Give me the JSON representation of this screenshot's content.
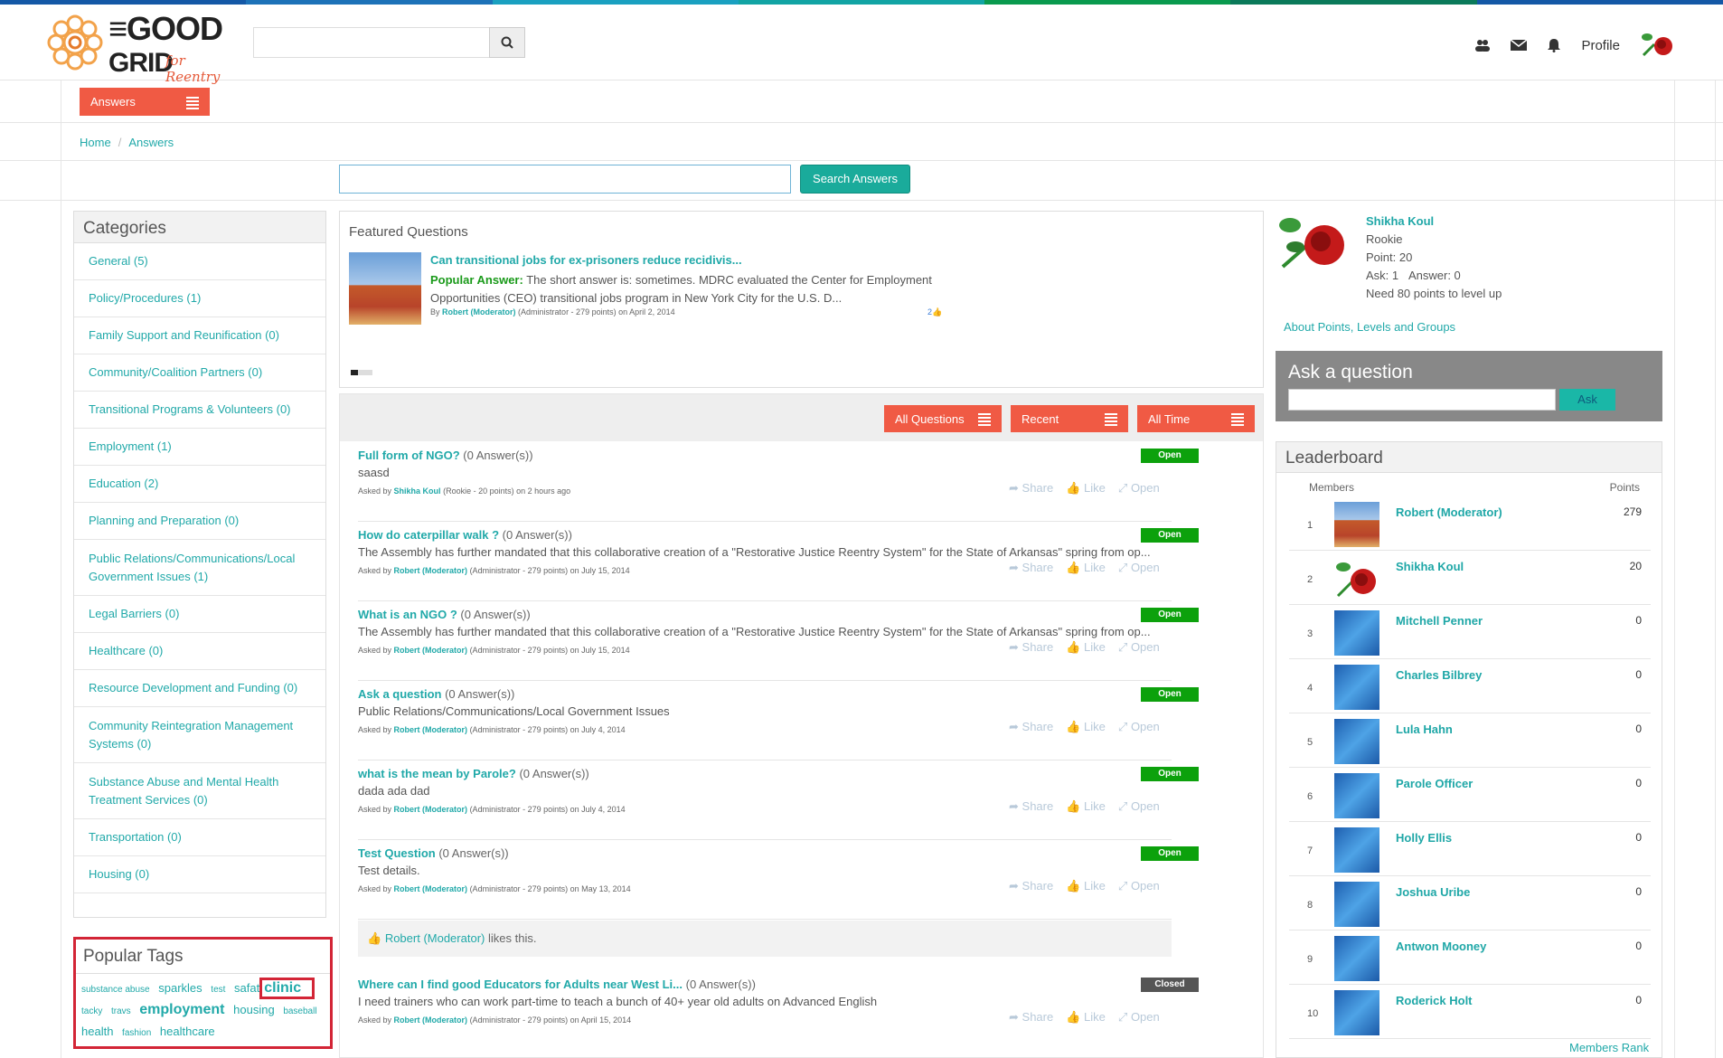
{
  "colors": {
    "bar": [
      "#1458a6",
      "#1d72b8",
      "#1aa0c0",
      "#12a4a4",
      "#0a9a4e",
      "#0b7a5a",
      "#1458a6"
    ],
    "accent": "#f05a44",
    "teal": "#1fa7a7"
  },
  "header": {
    "logo_main": "THE GOOD GRID",
    "logo_sub": "for Reentry",
    "search_placeholder": "",
    "profile": "Profile"
  },
  "answers_menu": "Answers",
  "breadcrumb": {
    "home": "Home",
    "current": "Answers"
  },
  "search_answers": "Search Answers",
  "categories": {
    "title": "Categories",
    "items": [
      "General (5)",
      "Policy/Procedures (1)",
      "Family Support and Reunification (0)",
      "Community/Coalition Partners (0)",
      "Transitional Programs & Volunteers (0)",
      "Employment (1)",
      "Education (2)",
      "Planning and Preparation (0)",
      "Public Relations/Communications/Local Government Issues (1)",
      "Legal Barriers (0)",
      "Healthcare (0)",
      "Resource Development and Funding (0)",
      "Community Reintegration Management Systems (0)",
      "Substance Abuse and Mental Health Treatment Services (0)",
      "Transportation (0)",
      "Housing (0)"
    ]
  },
  "tags": {
    "title": "Popular Tags",
    "list": [
      "substance abuse",
      "sparkles",
      "test",
      "safat",
      "clinic",
      "tacky",
      "travs",
      "employment",
      "housing",
      "baseball",
      "health",
      "fashion",
      "healthcare"
    ]
  },
  "featured": {
    "title": "Featured Questions",
    "question": "Can transitional jobs for ex-prisoners reduce recidivis...",
    "answer_label": "Popular Answer:",
    "answer_text": "The short answer is: sometimes. MDRC evaluated the Center for Employment Opportunities (CEO) transitional jobs program in New York City for the U.S. D...",
    "meta_by": "By",
    "meta_author": "Robert (Moderator)",
    "meta_rest": "(Administrator - 279 points)  on April 2, 2014",
    "likes": "2"
  },
  "filters": {
    "all": "All Questions",
    "recent": "Recent",
    "time": "All Time"
  },
  "questions": [
    {
      "title": "Full form of NGO?",
      "count": "(0 Answer(s))",
      "desc": "saasd",
      "asked_by": "Asked by",
      "author": "Shikha Koul",
      "meta": "(Rookie - 20 points)  on 2 hours ago",
      "status": "Open"
    },
    {
      "title": "How do caterpillar walk ?",
      "count": "(0 Answer(s))",
      "desc": "The Assembly has further mandated that this collaborative creation of a \"Restorative Justice Reentry System\" for the State of Arkansas\" spring from op...",
      "asked_by": "Asked by",
      "author": "Robert (Moderator)",
      "meta": "(Administrator - 279 points)  on July 15, 2014",
      "status": "Open"
    },
    {
      "title": "What is an NGO ?",
      "count": "(0 Answer(s))",
      "desc": "The Assembly has further mandated that this collaborative creation of a \"Restorative Justice Reentry System\" for the State of Arkansas\" spring from op...",
      "asked_by": "Asked by",
      "author": "Robert (Moderator)",
      "meta": "(Administrator - 279 points)  on July 15, 2014",
      "status": "Open"
    },
    {
      "title": "Ask a question",
      "count": "(0 Answer(s))",
      "desc": "Public Relations/Communications/Local Government Issues",
      "asked_by": "Asked by",
      "author": "Robert (Moderator)",
      "meta": "(Administrator - 279 points)  on July 4, 2014",
      "status": "Open"
    },
    {
      "title": "what is the mean by Parole?",
      "count": "(0 Answer(s))",
      "desc": "dada ada dad",
      "asked_by": "Asked by",
      "author": "Robert (Moderator)",
      "meta": "(Administrator - 279 points)  on July 4, 2014",
      "status": "Open"
    },
    {
      "title": "Test Question",
      "count": "(0 Answer(s))",
      "desc": "Test details.",
      "asked_by": "Asked by",
      "author": "Robert (Moderator)",
      "meta": "(Administrator - 279 points)  on May 13, 2014",
      "status": "Open"
    },
    {
      "title": "Where can I find good Educators for Adults near West Li...",
      "count": "(0 Answer(s))",
      "desc": "I need trainers who can work part-time to teach a bunch of 40+ year old adults on Advanced English",
      "asked_by": "Asked by",
      "author": "Robert (Moderator)",
      "meta": "(Administrator - 279 points)  on April 15, 2014",
      "status": "Closed"
    }
  ],
  "actions": {
    "share": "Share",
    "like": "Like",
    "open": "Open"
  },
  "likes_bar": {
    "name": "Robert (Moderator)",
    "text": "likes this."
  },
  "user": {
    "name": "Shikha Koul",
    "level": "Rookie",
    "points": "Point: 20",
    "ask": "Ask: 1",
    "answer": "Answer: 0",
    "need": "Need 80 points to level up"
  },
  "about_link": "About Points, Levels and Groups",
  "ask": {
    "title": "Ask a question",
    "button": "Ask"
  },
  "leaderboard": {
    "title": "Leaderboard",
    "members": "Members",
    "points": "Points",
    "rows": [
      {
        "rank": "1",
        "name": "Robert (Moderator)",
        "pts": "279"
      },
      {
        "rank": "2",
        "name": "Shikha Koul",
        "pts": "20"
      },
      {
        "rank": "3",
        "name": "Mitchell Penner",
        "pts": "0"
      },
      {
        "rank": "4",
        "name": "Charles Bilbrey",
        "pts": "0"
      },
      {
        "rank": "5",
        "name": "Lula Hahn",
        "pts": "0"
      },
      {
        "rank": "6",
        "name": "Parole Officer",
        "pts": "0"
      },
      {
        "rank": "7",
        "name": "Holly Ellis",
        "pts": "0"
      },
      {
        "rank": "8",
        "name": "Joshua Uribe",
        "pts": "0"
      },
      {
        "rank": "9",
        "name": "Antwon Mooney",
        "pts": "0"
      },
      {
        "rank": "10",
        "name": "Roderick Holt",
        "pts": "0"
      }
    ],
    "members_rank": "Members Rank"
  }
}
